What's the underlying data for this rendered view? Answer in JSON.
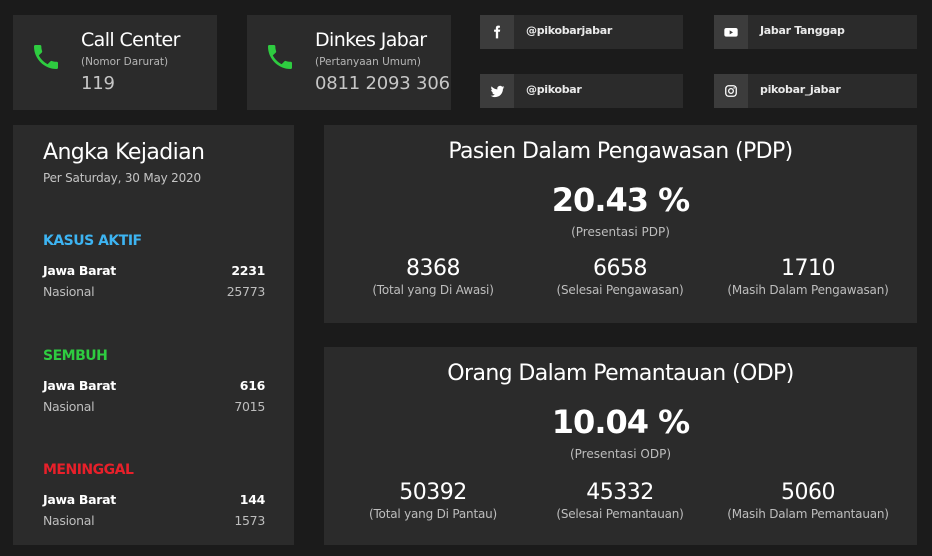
{
  "contacts": [
    {
      "title": "Call Center",
      "subtitle": "(Nomor Darurat)",
      "number": "119"
    },
    {
      "title": "Dinkes Jabar",
      "subtitle": "(Pertanyaan Umum)",
      "number": "0811 2093 306"
    }
  ],
  "social": [
    {
      "icon": "facebook-icon",
      "handle": "@pikobarjabar"
    },
    {
      "icon": "youtube-icon",
      "handle": "Jabar Tanggap"
    },
    {
      "icon": "twitter-icon",
      "handle": "@pikobar"
    },
    {
      "icon": "instagram-icon",
      "handle": "pikobar_jabar"
    }
  ],
  "angka": {
    "title": "Angka Kejadian",
    "date": "Per Saturday, 30 May 2020",
    "sections": [
      {
        "label": "KASUS AKTIF",
        "color": "#3db4f2",
        "rows": [
          {
            "name": "Jawa Barat",
            "value": "2231"
          },
          {
            "name": "Nasional",
            "value": "25773"
          }
        ]
      },
      {
        "label": "SEMBUH",
        "color": "#2ecc40",
        "rows": [
          {
            "name": "Jawa Barat",
            "value": "616"
          },
          {
            "name": "Nasional",
            "value": "7015"
          }
        ]
      },
      {
        "label": "MENINGGAL",
        "color": "#e8202a",
        "rows": [
          {
            "name": "Jawa Barat",
            "value": "144"
          },
          {
            "name": "Nasional",
            "value": "1573"
          }
        ]
      }
    ]
  },
  "pdp": {
    "title": "Pasien Dalam Pengawasan (PDP)",
    "percent": "20.43 %",
    "percent_label": "(Presentasi PDP)",
    "stats": [
      {
        "value": "8368",
        "label": "(Total yang Di Awasi)"
      },
      {
        "value": "6658",
        "label": "(Selesai Pengawasan)"
      },
      {
        "value": "1710",
        "label": "(Masih Dalam Pengawasan)"
      }
    ]
  },
  "odp": {
    "title": "Orang Dalam Pemantauan (ODP)",
    "percent": "10.04 %",
    "percent_label": "(Presentasi ODP)",
    "stats": [
      {
        "value": "50392",
        "label": "(Total yang Di Pantau)"
      },
      {
        "value": "45332",
        "label": "(Selesai Pemantauan)"
      },
      {
        "value": "5060",
        "label": "(Masih Dalam Pemantauan)"
      }
    ]
  },
  "colors": {
    "background": "#1b1b1b",
    "card": "#2b2b2b",
    "phone": "#2ecc40"
  }
}
